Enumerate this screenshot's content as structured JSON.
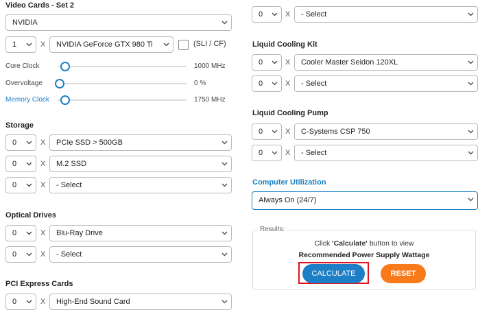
{
  "left": {
    "video_cards": {
      "title": "Video Cards - Set 2",
      "brand": "NVIDIA",
      "qty": "1",
      "model": "NVIDIA GeForce GTX 980 Ti",
      "sli_label": "(SLI / CF)",
      "sliders": [
        {
          "label": "Core Clock",
          "value": "1000 MHz",
          "level": 0.05
        },
        {
          "label": "Overvoltage",
          "value": "0 %",
          "level": 0.0
        },
        {
          "label": "Memory Clock",
          "value": "1750 MHz",
          "level": 0.05
        }
      ]
    },
    "storage": {
      "title": "Storage",
      "rows": [
        {
          "qty": "0",
          "item": "PCIe SSD > 500GB"
        },
        {
          "qty": "0",
          "item": "M.2 SSD"
        },
        {
          "qty": "0",
          "item": "- Select"
        }
      ]
    },
    "optical": {
      "title": "Optical Drives",
      "rows": [
        {
          "qty": "0",
          "item": "Blu-Ray Drive"
        },
        {
          "qty": "0",
          "item": "- Select"
        }
      ]
    },
    "pcie": {
      "title": "PCI Express Cards",
      "rows": [
        {
          "qty": "0",
          "item": "High-End Sound Card"
        }
      ]
    }
  },
  "right": {
    "top_row": {
      "qty": "0",
      "item": "- Select"
    },
    "liquid_kit": {
      "title": "Liquid Cooling Kit",
      "rows": [
        {
          "qty": "0",
          "item": "Cooler Master Seidon 120XL"
        },
        {
          "qty": "0",
          "item": "- Select"
        }
      ]
    },
    "liquid_pump": {
      "title": "Liquid Cooling Pump",
      "rows": [
        {
          "qty": "0",
          "item": "C-Systems CSP 750"
        },
        {
          "qty": "0",
          "item": "- Select"
        }
      ]
    },
    "utilization": {
      "title": "Computer Utilization",
      "value": "Always On (24/7)"
    },
    "results": {
      "legend": "Results:",
      "line1_prefix": "Click ",
      "line1_bold": "'Calculate'",
      "line1_suffix": " button to view",
      "line2": "Recommended Power Supply Wattage",
      "calculate_label": "CALCULATE",
      "reset_label": "RESET"
    }
  },
  "x_symbol": "X",
  "colors": {
    "accent": "#1a7fc4",
    "calculate": "#1d7fc6",
    "reset": "#f97a1b",
    "highlight": "#e0141e"
  }
}
